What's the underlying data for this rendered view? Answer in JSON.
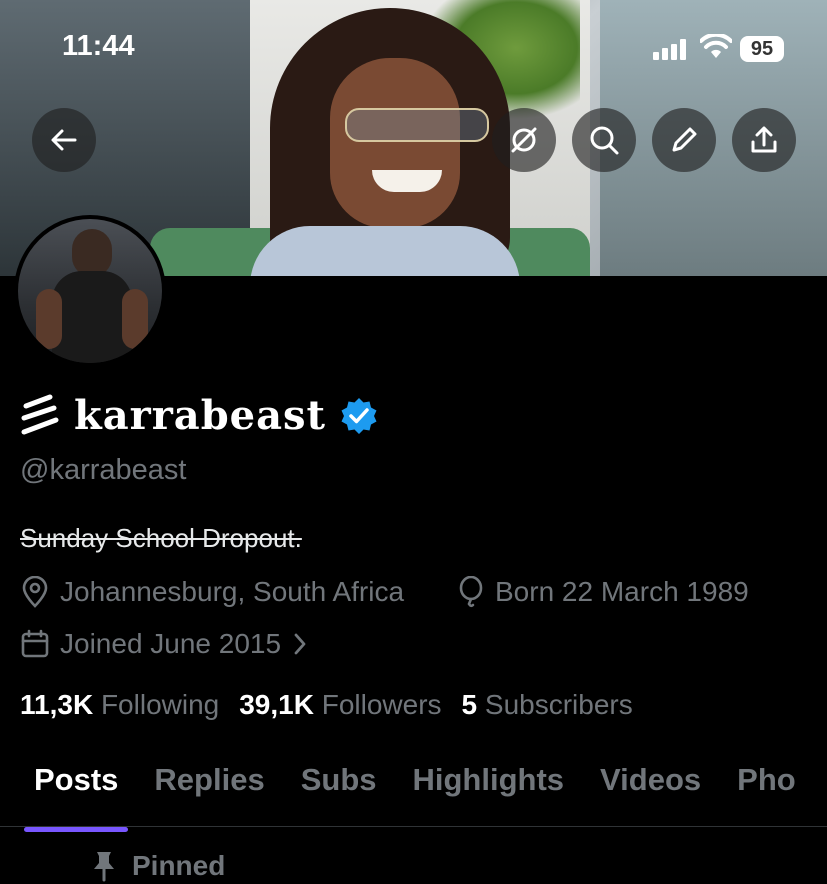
{
  "status_bar": {
    "time": "11:44",
    "battery": "95"
  },
  "header": {
    "back_icon": "arrow-left-icon",
    "action_icons": [
      "grok-icon",
      "search-icon",
      "pencil-icon",
      "share-icon"
    ]
  },
  "profile": {
    "display_name": "karrabeast",
    "handle": "@karrabeast",
    "bio": "Sunday School Dropout.",
    "location": "Johannesburg, South Africa",
    "birthday": "Born 22 March 1989",
    "joined": "Joined June 2015",
    "verified_color": "#1d9bf0",
    "stats": {
      "following_count": "11,3K",
      "following_label": "Following",
      "followers_count": "39,1K",
      "followers_label": "Followers",
      "subscribers_count": "5",
      "subscribers_label": "Subscribers"
    }
  },
  "tabs": [
    "Posts",
    "Replies",
    "Subs",
    "Highlights",
    "Videos",
    "Pho"
  ],
  "active_tab": "Posts",
  "pinned_label": "Pinned",
  "accent_color": "#7856ff"
}
